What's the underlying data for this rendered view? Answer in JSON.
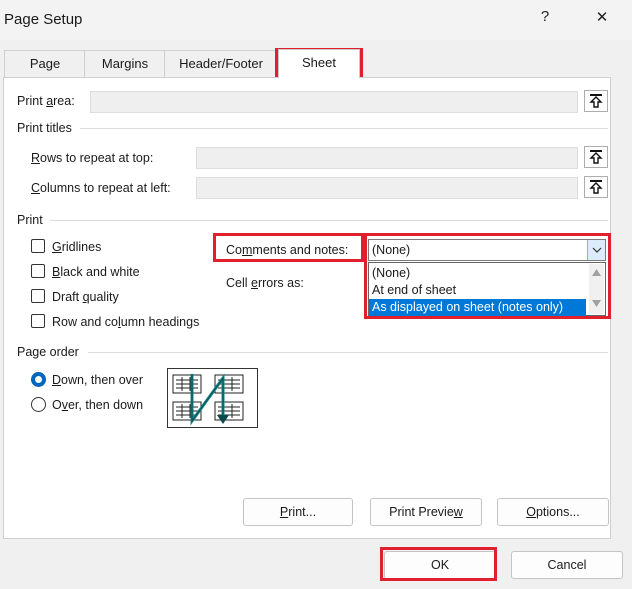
{
  "window": {
    "title": "Page Setup",
    "help_glyph": "?",
    "close_glyph": "✕"
  },
  "tabs": [
    {
      "label": "Page"
    },
    {
      "label": "Margins"
    },
    {
      "label": "Header/Footer"
    },
    {
      "label": "Sheet",
      "active": true
    }
  ],
  "print_area": {
    "label_pre": "Print ",
    "label_u": "a",
    "label_post": "rea:",
    "value": ""
  },
  "print_titles": {
    "heading": "Print titles",
    "rows": {
      "label_pre": "",
      "label_u": "R",
      "label_post": "ows to repeat at top:",
      "value": ""
    },
    "columns": {
      "label_pre": "",
      "label_u": "C",
      "label_post": "olumns to repeat at left:",
      "value": ""
    }
  },
  "print": {
    "heading": "Print",
    "gridlines": {
      "pre": "",
      "u": "G",
      "post": "ridlines",
      "checked": false
    },
    "black_white": {
      "pre": "",
      "u": "B",
      "post": "lack and white",
      "checked": false
    },
    "draft": {
      "pre": "Draft ",
      "u": "q",
      "post": "uality",
      "checked": false
    },
    "headings": {
      "pre": "Row and co",
      "u": "l",
      "post": "umn headings",
      "checked": false
    },
    "comments": {
      "pre": "Co",
      "u": "m",
      "post": "ments and notes:",
      "selected": "(None)"
    },
    "cell_errors": {
      "pre": "Cell ",
      "u": "e",
      "post": "rrors as:"
    },
    "dropdown_options": [
      "(None)",
      "At end of sheet",
      "As displayed on sheet (notes only)"
    ],
    "highlighted_option_index": 2
  },
  "page_order": {
    "heading": "Page order",
    "down_then_over": {
      "pre": "",
      "u": "D",
      "post": "own, then over",
      "selected": true
    },
    "over_then_down": {
      "pre": "O",
      "u": "v",
      "post": "er, then down",
      "selected": false
    }
  },
  "buttons": {
    "print": {
      "pre": "",
      "u": "P",
      "post": "rint..."
    },
    "print_preview": {
      "pre": "Print Previe",
      "u": "w",
      "post": ""
    },
    "options": {
      "pre": "",
      "u": "O",
      "post": "ptions..."
    },
    "ok": "OK",
    "cancel": "Cancel"
  },
  "colors": {
    "highlight_red": "#e0202c",
    "selection_blue": "#0078d7",
    "radio_blue": "#0067c0",
    "arrow_teal": "#17868a"
  },
  "icons": [
    "upload-arrow-icon",
    "help-icon",
    "close-icon",
    "chevron-down-icon",
    "page-order-diagram-icon"
  ]
}
